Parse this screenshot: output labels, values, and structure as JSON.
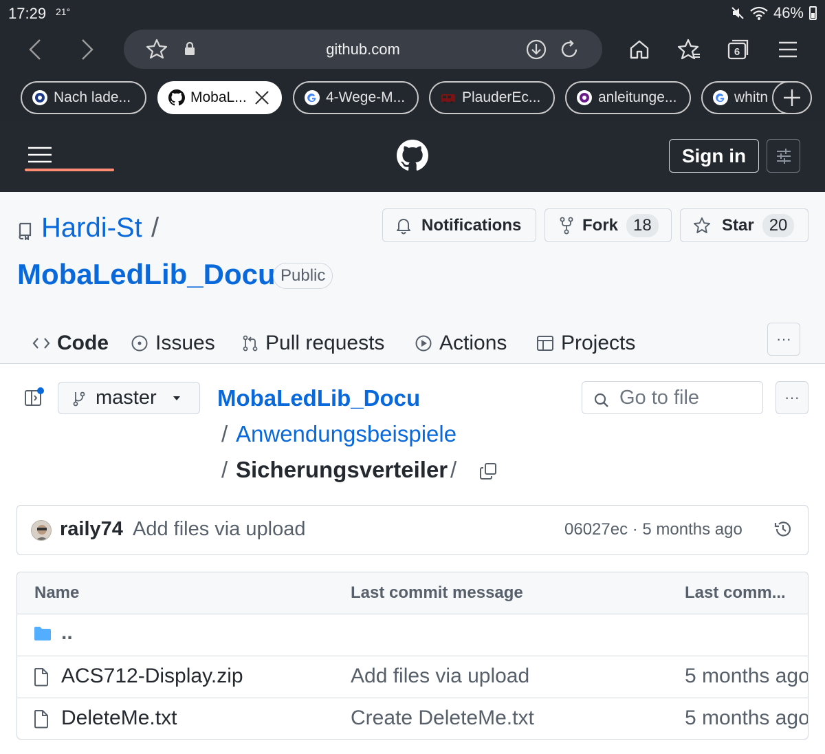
{
  "status_bar": {
    "time": "17:29",
    "temperature": "21°",
    "battery": "46%",
    "icons": [
      "mute-icon",
      "wifi-icon",
      "battery-icon"
    ]
  },
  "browser": {
    "url": "github.com",
    "tabs": [
      {
        "label": "Nach lade...",
        "favicon": "site-badge-icon",
        "active": false
      },
      {
        "label": "MobaL...",
        "favicon": "github-icon",
        "active": true
      },
      {
        "label": "4-Wege-M...",
        "favicon": "google-icon",
        "active": false
      },
      {
        "label": "PlauderEc...",
        "favicon": "train-icon",
        "active": false
      },
      {
        "label": "anleitunge...",
        "favicon": "site-badge-icon",
        "active": false
      },
      {
        "label": "whitn",
        "favicon": "google-icon",
        "active": false
      }
    ],
    "tab_count": "6"
  },
  "gh_header": {
    "sign_in": "Sign in"
  },
  "repo": {
    "owner": "Hardi-St",
    "separator": "/",
    "name": "MobaLedLib_Docu",
    "visibility": "Public",
    "notifications_label": "Notifications",
    "fork_label": "Fork",
    "fork_count": "18",
    "star_label": "Star",
    "star_count": "20",
    "tabs": [
      {
        "label": "Code",
        "icon": "code-icon",
        "active": true
      },
      {
        "label": "Issues",
        "icon": "issue-icon",
        "active": false
      },
      {
        "label": "Pull requests",
        "icon": "pull-request-icon",
        "active": false
      },
      {
        "label": "Actions",
        "icon": "play-icon",
        "active": false
      },
      {
        "label": "Projects",
        "icon": "table-icon",
        "active": false
      }
    ],
    "more": "···"
  },
  "file_nav": {
    "branch": "master",
    "breadcrumb": {
      "root": "MobaLedLib_Docu",
      "middle": "Anwendungsbeispiele",
      "current": "Sicherungsverteiler",
      "sep": "/"
    },
    "go_to_file_placeholder": "Go to file",
    "more": "···"
  },
  "commit": {
    "author": "raily74",
    "message": "Add files via upload",
    "meta": "06027ec · 5 months ago"
  },
  "file_table": {
    "headers": [
      "Name",
      "Last commit message",
      "Last comm..."
    ],
    "parent": "..",
    "rows": [
      {
        "name": "ACS712-Display.zip",
        "message": "Add files via upload",
        "date": "5 months ago"
      },
      {
        "name": "DeleteMe.txt",
        "message": "Create DeleteMe.txt",
        "date": "5 months ago"
      }
    ]
  },
  "colors": {
    "link": "#0969da",
    "browser_chrome": "#23272e",
    "github_header": "#24292f",
    "tab_underline": "#fd8c73"
  }
}
